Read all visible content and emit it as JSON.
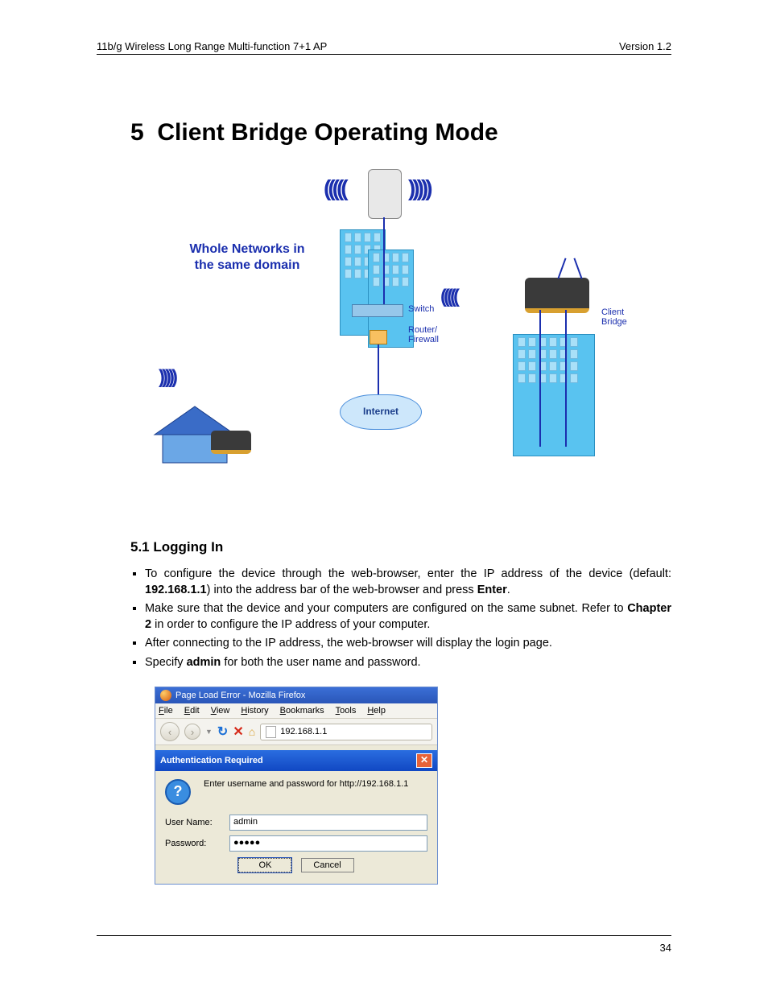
{
  "header": {
    "left": "11b/g Wireless Long Range Multi-function 7+1 AP",
    "right": "Version 1.2"
  },
  "chapter": {
    "number": "5",
    "title": "Client Bridge Operating Mode"
  },
  "diagram": {
    "caption_line1": "Whole Networks in",
    "caption_line2": "the same domain",
    "switch_label": "Switch",
    "router_label": "Router/\nFirewall",
    "internet_label": "Internet",
    "client_bridge_label": "Client\nBridge"
  },
  "section": {
    "number": "5.1",
    "title": "Logging In"
  },
  "bullets": [
    {
      "pre": "To configure the device through the web-browser, enter the IP address of the device (default: ",
      "bold1": "192.168.1.1",
      "mid": ") into the address bar of the web-browser and press ",
      "bold2": "Enter",
      "post": "."
    },
    {
      "pre": "Make sure that the device and your computers are configured on the same subnet. Refer to ",
      "bold1": "Chapter 2",
      "mid": " in order to configure the IP address of your computer.",
      "bold2": "",
      "post": ""
    },
    {
      "pre": "After connecting to the IP address, the web-browser will display the login page.",
      "bold1": "",
      "mid": "",
      "bold2": "",
      "post": ""
    },
    {
      "pre": "Specify ",
      "bold1": "admin",
      "mid": " for both the user name and password.",
      "bold2": "",
      "post": ""
    }
  ],
  "firefox": {
    "title": "Page Load Error - Mozilla Firefox",
    "menu": [
      "File",
      "Edit",
      "View",
      "History",
      "Bookmarks",
      "Tools",
      "Help"
    ],
    "url": "192.168.1.1",
    "auth": {
      "title": "Authentication Required",
      "message": "Enter username and password for http://192.168.1.1",
      "username_label": "User Name:",
      "username_value": "admin",
      "password_label": "Password:",
      "password_value": "●●●●●",
      "ok": "OK",
      "cancel": "Cancel"
    }
  },
  "page_number": "34"
}
